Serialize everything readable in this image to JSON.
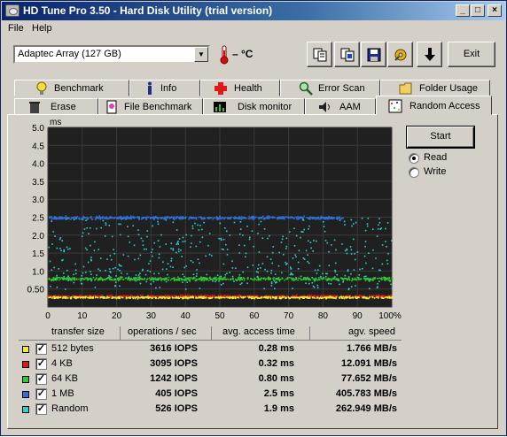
{
  "window": {
    "title": "HD Tune Pro 3.50 - Hard Disk Utility (trial version)",
    "min_label": "_",
    "max_label": "□",
    "close_label": "×"
  },
  "menu": {
    "file": "File",
    "help": "Help"
  },
  "toolbar": {
    "drive": "Adaptec Array (127 GB)",
    "temperature": "– °C",
    "exit_label": "Exit",
    "icons": [
      "copy-icon",
      "copy-info-icon",
      "save-icon",
      "options-icon",
      "download-icon"
    ]
  },
  "tabs_row1": [
    {
      "label": "Benchmark",
      "icon": "benchmark-icon"
    },
    {
      "label": "Info",
      "icon": "info-icon"
    },
    {
      "label": "Health",
      "icon": "health-icon"
    },
    {
      "label": "Error Scan",
      "icon": "error-scan-icon"
    },
    {
      "label": "Folder Usage",
      "icon": "folder-icon"
    }
  ],
  "tabs_row2": [
    {
      "label": "Erase",
      "icon": "trash-icon"
    },
    {
      "label": "File Benchmark",
      "icon": "file-benchmark-icon"
    },
    {
      "label": "Disk monitor",
      "icon": "disk-monitor-icon"
    },
    {
      "label": "AAM",
      "icon": "speaker-icon"
    },
    {
      "label": "Random Access",
      "icon": "random-access-icon",
      "active": true
    }
  ],
  "controls": {
    "start_label": "Start",
    "read_label": "Read",
    "write_label": "Write",
    "mode": "Read"
  },
  "table": {
    "headers": [
      "transfer size",
      "operations / sec",
      "avg. access time",
      "agv. speed"
    ],
    "rows": [
      {
        "name": "512 bytes",
        "color": "#f0e838",
        "checked": true,
        "ops": "3616 IOPS",
        "access": "0.28 ms",
        "speed": "1.766 MB/s"
      },
      {
        "name": "4 KB",
        "color": "#e01818",
        "checked": true,
        "ops": "3095 IOPS",
        "access": "0.32 ms",
        "speed": "12.091 MB/s"
      },
      {
        "name": "64 KB",
        "color": "#30c830",
        "checked": true,
        "ops": "1242 IOPS",
        "access": "0.80 ms",
        "speed": "77.652 MB/s"
      },
      {
        "name": "1 MB",
        "color": "#3070d8",
        "checked": true,
        "ops": "405 IOPS",
        "access": "2.5 ms",
        "speed": "405.783 MB/s"
      },
      {
        "name": "Random",
        "color": "#30d0d0",
        "checked": true,
        "ops": "526 IOPS",
        "access": "1.9 ms",
        "speed": "262.949 MB/s"
      }
    ]
  },
  "chart_data": {
    "type": "scatter",
    "ylabel": "ms",
    "ylim": [
      0,
      5
    ],
    "xlim": [
      0,
      100
    ],
    "yticks": [
      "5.0",
      "4.5",
      "4.0",
      "3.5",
      "3.0",
      "2.5",
      "2.0",
      "1.5",
      "1.0",
      "0.50"
    ],
    "xticks": [
      "0",
      "10",
      "20",
      "30",
      "40",
      "50",
      "60",
      "70",
      "80",
      "90",
      "100%"
    ],
    "grid": true,
    "background": "#202020",
    "series": [
      {
        "name": "512 bytes",
        "color": "#f0e838",
        "mean_ms": 0.28,
        "spread_ms": 0.04,
        "x_end": 100,
        "kind": "band"
      },
      {
        "name": "4 KB",
        "color": "#e01818",
        "mean_ms": 0.32,
        "spread_ms": 0.04,
        "x_end": 100,
        "kind": "band"
      },
      {
        "name": "64 KB",
        "color": "#30c830",
        "mean_ms": 0.8,
        "spread_ms": 0.07,
        "x_end": 100,
        "kind": "band"
      },
      {
        "name": "1 MB",
        "color": "#3070d8",
        "mean_ms": 2.5,
        "spread_ms": 0.06,
        "x_end": 86,
        "kind": "band"
      },
      {
        "name": "Random",
        "color": "#30d0d0",
        "mean_ms": 1.9,
        "spread_ms": 0.9,
        "x_end": 100,
        "kind": "cloud"
      }
    ]
  }
}
